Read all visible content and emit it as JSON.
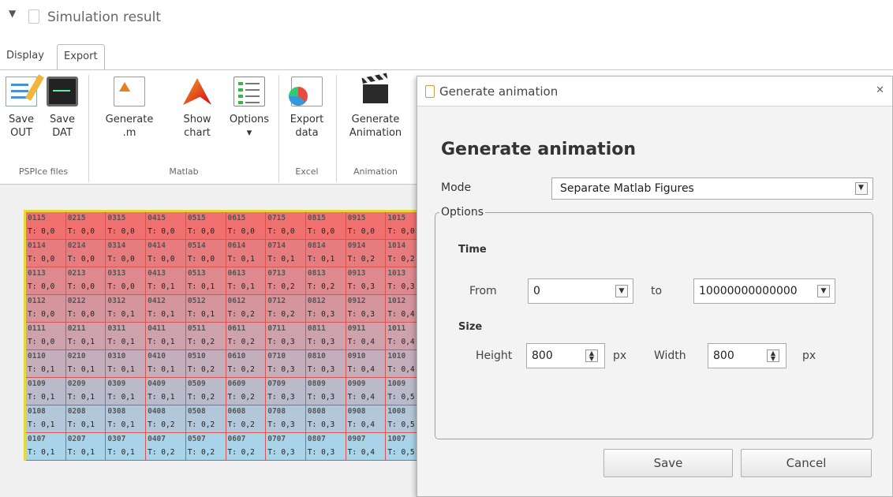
{
  "window": {
    "title": "Simulation result",
    "menu_glyph": "≡"
  },
  "tabs": [
    {
      "label": "Display"
    },
    {
      "label": "Export"
    }
  ],
  "ribbon": {
    "buttons": [
      {
        "line1": "Save",
        "line2": "OUT",
        "icon": "save-out-icon"
      },
      {
        "line1": "Save",
        "line2": "DAT",
        "icon": "save-dat-icon"
      },
      {
        "line1": "Generate",
        "line2": ".m",
        "icon": "generate-m-icon"
      },
      {
        "line1": "Show",
        "line2": "chart",
        "icon": "matlab-icon"
      },
      {
        "line1": "Options",
        "line2": "▾",
        "icon": "options-list-icon"
      },
      {
        "line1": "Export",
        "line2": "data",
        "icon": "excel-export-icon"
      },
      {
        "line1": "Generate",
        "line2": "Animation",
        "icon": "clapperboard-icon"
      }
    ],
    "groups": [
      "PSPIce files",
      "Matlab",
      "Excel",
      "Animation"
    ]
  },
  "grid": {
    "rows": [
      {
        "ids": [
          "0115",
          "0215",
          "0315",
          "0415",
          "0515",
          "0615",
          "0715",
          "0815",
          "0915",
          "1015"
        ],
        "vals": [
          "T: 0,0",
          "T: 0,0",
          "T: 0,0",
          "T: 0,0",
          "T: 0,0",
          "T: 0,0",
          "T: 0,0",
          "T: 0,0",
          "T: 0,0",
          "T: 0,0"
        ]
      },
      {
        "ids": [
          "0114",
          "0214",
          "0314",
          "0414",
          "0514",
          "0614",
          "0714",
          "0814",
          "0914",
          "1014"
        ],
        "vals": [
          "T: 0,0",
          "T: 0,0",
          "T: 0,0",
          "T: 0,0",
          "T: 0,0",
          "T: 0,1",
          "T: 0,1",
          "T: 0,1",
          "T: 0,2",
          "T: 0,2"
        ]
      },
      {
        "ids": [
          "0113",
          "0213",
          "0313",
          "0413",
          "0513",
          "0613",
          "0713",
          "0813",
          "0913",
          "1013"
        ],
        "vals": [
          "T: 0,0",
          "T: 0,0",
          "T: 0,0",
          "T: 0,1",
          "T: 0,1",
          "T: 0,1",
          "T: 0,2",
          "T: 0,2",
          "T: 0,3",
          "T: 0,3"
        ]
      },
      {
        "ids": [
          "0112",
          "0212",
          "0312",
          "0412",
          "0512",
          "0612",
          "0712",
          "0812",
          "0912",
          "1012"
        ],
        "vals": [
          "T: 0,0",
          "T: 0,0",
          "T: 0,1",
          "T: 0,1",
          "T: 0,1",
          "T: 0,2",
          "T: 0,2",
          "T: 0,3",
          "T: 0,3",
          "T: 0,4"
        ]
      },
      {
        "ids": [
          "0111",
          "0211",
          "0311",
          "0411",
          "0511",
          "0611",
          "0711",
          "0811",
          "0911",
          "1011"
        ],
        "vals": [
          "T: 0,0",
          "T: 0,1",
          "T: 0,1",
          "T: 0,1",
          "T: 0,2",
          "T: 0,2",
          "T: 0,3",
          "T: 0,3",
          "T: 0,4",
          "T: 0,4"
        ]
      },
      {
        "ids": [
          "0110",
          "0210",
          "0310",
          "0410",
          "0510",
          "0610",
          "0710",
          "0810",
          "0910",
          "1010"
        ],
        "vals": [
          "T: 0,1",
          "T: 0,1",
          "T: 0,1",
          "T: 0,1",
          "T: 0,2",
          "T: 0,2",
          "T: 0,3",
          "T: 0,3",
          "T: 0,4",
          "T: 0,4"
        ]
      },
      {
        "ids": [
          "0109",
          "0209",
          "0309",
          "0409",
          "0509",
          "0609",
          "0709",
          "0809",
          "0909",
          "1009"
        ],
        "vals": [
          "T: 0,1",
          "T: 0,1",
          "T: 0,1",
          "T: 0,1",
          "T: 0,2",
          "T: 0,2",
          "T: 0,3",
          "T: 0,3",
          "T: 0,4",
          "T: 0,5"
        ]
      },
      {
        "ids": [
          "0108",
          "0208",
          "0308",
          "0408",
          "0508",
          "0608",
          "0708",
          "0808",
          "0908",
          "1008"
        ],
        "vals": [
          "T: 0,1",
          "T: 0,1",
          "T: 0,1",
          "T: 0,2",
          "T: 0,2",
          "T: 0,2",
          "T: 0,3",
          "T: 0,3",
          "T: 0,4",
          "T: 0,5"
        ]
      },
      {
        "ids": [
          "0107",
          "0207",
          "0307",
          "0407",
          "0507",
          "0607",
          "0707",
          "0807",
          "0907",
          "1007"
        ],
        "vals": [
          "T: 0,1",
          "T: 0,1",
          "T: 0,1",
          "T: 0,2",
          "T: 0,2",
          "T: 0,2",
          "T: 0,3",
          "T: 0,3",
          "T: 0,4",
          "T: 0,5"
        ]
      }
    ],
    "colors": {
      "hot": "#f07070",
      "cool": "#a9d3e8",
      "border": "#d9534f",
      "frame": "#e8d93a"
    }
  },
  "dialog": {
    "title": "Generate animation",
    "close_glyph": "✕",
    "heading": "Generate animation",
    "mode_label": "Mode",
    "mode_value": "Separate Matlab Figures",
    "options_legend": "Options",
    "time_label": "Time",
    "from_label": "From",
    "from_value": "0",
    "to_label": "to",
    "to_value": "10000000000000",
    "size_label": "Size",
    "height_label": "Height",
    "height_value": "800",
    "width_label": "Width",
    "width_value": "800",
    "px_unit": "px",
    "save_label": "Save",
    "cancel_label": "Cancel"
  }
}
